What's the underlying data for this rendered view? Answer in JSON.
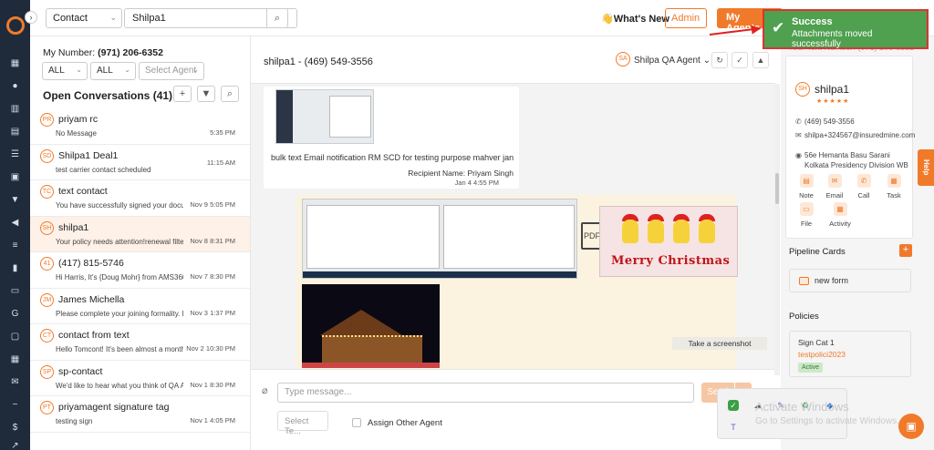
{
  "topbar": {
    "contact_select": "Contact",
    "search_value": "Shilpa1",
    "whats_new": "👋What's New",
    "role_select": "Admin",
    "my_agents": "My Agents"
  },
  "toast": {
    "title": "Success",
    "message": "Attachments moved successfully"
  },
  "left_panel": {
    "my_number_label": "My Number:",
    "my_number": "(971) 206-6352",
    "filter1": "ALL",
    "filter2": "ALL",
    "agent_placeholder": "Select Agent",
    "open_conversations": "Open Conversations (41)",
    "conversations": [
      {
        "initials": "PR",
        "name": "priyam rc",
        "preview": "No Message",
        "time": "5:35 PM"
      },
      {
        "initials": "SD",
        "name": "Shilpa1 Deal1",
        "preview": "test carrier contact scheduled",
        "time": "11:15 AM"
      },
      {
        "initials": "TC",
        "name": "text contact",
        "preview": "You have successfully signed your docun",
        "time": "Nov 9 5:05 PM"
      },
      {
        "initials": "SH",
        "name": "shilpa1",
        "preview": "Your policy needs attention!renewal filter",
        "time": "Nov 8 8:31 PM"
      },
      {
        "initials": "41",
        "name": "(417) 815-5746",
        "preview": "Hi Harris, It's {Doug Mohr} from AMS360 in",
        "time": "Nov 7 8:30 PM"
      },
      {
        "initials": "JM",
        "name": "James Michella",
        "preview": "Please complete your joining formality. Pl",
        "time": "Nov 3 1:37 PM"
      },
      {
        "initials": "CT",
        "name": "contact from text",
        "preview": "Hello Tomcont! It's been almost a month",
        "time": "Nov 2 10:30 PM"
      },
      {
        "initials": "SP",
        "name": "sp-contact",
        "preview": "We'd like to hear what you think of QA Age",
        "time": "Nov 1 8:30 PM"
      },
      {
        "initials": "PT",
        "name": "priyamagent signature tag",
        "preview": "testing sign",
        "time": "Nov 1 4:05 PM"
      }
    ]
  },
  "chat": {
    "title": "shilpa1 - (469) 549-3556",
    "agent_initials": "SA",
    "agent_name": "Shilpa QA Agent",
    "message1_text": "bulk text Email notification RM SCD for testing purpose mahver jan",
    "message1_recipient": "Recipient Name: Priyam Singh",
    "message1_date": "Jan 4 4:55 PM",
    "pdf_label": "PDF",
    "xmas_text": "Merry Christmas",
    "screenshot_tip": "Take a screenshot",
    "input_placeholder": "Type message...",
    "send_label": "Send",
    "template_placeholder": "Select Te...",
    "assign_label": "Assign Other Agent"
  },
  "right_panel": {
    "your_number": "Your Text Number: (971) 206-6352",
    "contact_initials": "SH",
    "contact_name": "shilpa1",
    "stars": "★★★★★",
    "phone": "(469) 549-3556",
    "email": "shilpa+324567@insuredmine.com",
    "address": "56e Hemanta Basu Sarani Kolkata Presidency Division WB",
    "actions": [
      "Note",
      "Email",
      "Call",
      "Task",
      "File",
      "Activity"
    ],
    "pipeline_title": "Pipeline Cards",
    "pipeline_item": "new form",
    "policies_title": "Policies",
    "policy_name": "Sign Cat 1",
    "policy_number": "testpolici2023",
    "policy_status": "Active"
  },
  "help_tab": "Help",
  "watermark": {
    "line1": "Activate Windows",
    "line2": "Go to Settings to activate Windows."
  },
  "colors": {
    "accent": "#f07a2a",
    "rail": "#1f2a3b",
    "toast": "#4fa04f"
  }
}
